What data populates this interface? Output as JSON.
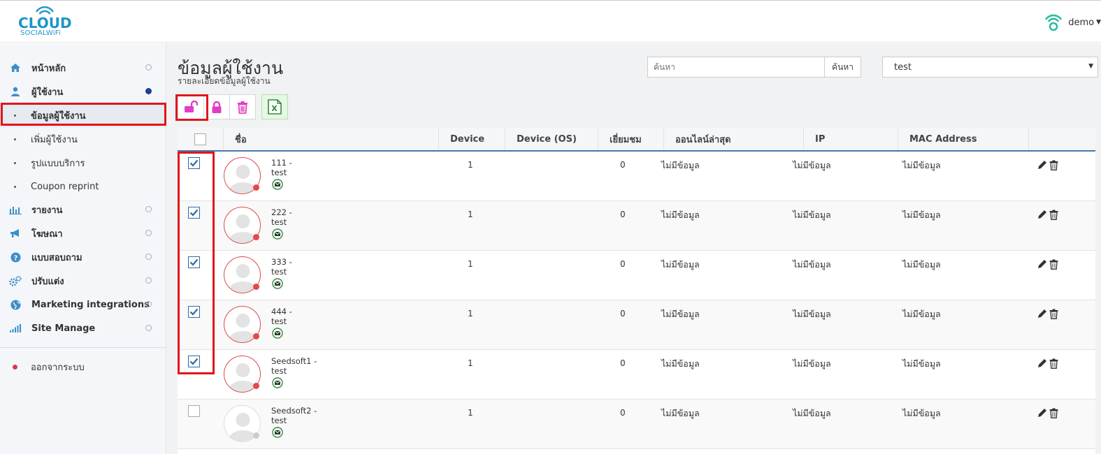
{
  "header": {
    "logo_main": "CLOUD",
    "logo_sub": "SOCIALWiFi",
    "user_name": "demo"
  },
  "sidebar": {
    "items": [
      {
        "label": "หน้าหลัก",
        "icon": "home-icon"
      },
      {
        "label": "ผู้ใช้งาน",
        "icon": "user-icon"
      },
      {
        "label": "รายงาน",
        "icon": "bar-chart-icon"
      },
      {
        "label": "โฆษณา",
        "icon": "megaphone-icon"
      },
      {
        "label": "แบบสอบถาม",
        "icon": "question-icon"
      },
      {
        "label": "ปรับแต่ง",
        "icon": "gears-icon"
      },
      {
        "label": "Marketing integrations",
        "icon": "globe-icon"
      },
      {
        "label": "Site Manage",
        "icon": "signal-icon"
      }
    ],
    "sub_items": [
      {
        "label": "ข้อมูลผู้ใช้งาน",
        "active": true
      },
      {
        "label": "เพิ่มผู้ใช้งาน",
        "active": false
      },
      {
        "label": "รูปแบบบริการ",
        "active": false
      },
      {
        "label": "Coupon reprint",
        "active": false
      }
    ],
    "logout": "ออกจากระบบ"
  },
  "main": {
    "title": "ข้อมูลผู้ใช้งาน",
    "subtitle": "รายละเอียดข้อมูลผู้ใช้งาน",
    "search": {
      "placeholder": "ค้นหา",
      "button": "ค้นหา"
    },
    "site_select": "test"
  },
  "toolbar": {
    "unlock_icon": "unlock-icon",
    "lock_icon": "lock-icon",
    "delete_icon": "trash-icon",
    "excel_icon": "excel-icon"
  },
  "colors": {
    "accent_blue": "#1d95c9",
    "magenta": "#e23ec4",
    "highlight_red": "#e0161b",
    "header_border": "#4a78a8"
  },
  "table": {
    "columns": [
      "ชื่อ",
      "Device",
      "Device (OS)",
      "เยี่ยมชม",
      "ออนไลน์ล่าสุด",
      "IP",
      "MAC Address"
    ],
    "rows": [
      {
        "checked": true,
        "name": "111 -",
        "site": "test",
        "device": "1",
        "os": "",
        "visits": "0",
        "last_online": "ไม่มีข้อมูล",
        "ip": "ไม่มีข้อมูล",
        "mac": "ไม่มีข้อมูล",
        "online": true
      },
      {
        "checked": true,
        "name": "222 -",
        "site": "test",
        "device": "1",
        "os": "",
        "visits": "0",
        "last_online": "ไม่มีข้อมูล",
        "ip": "ไม่มีข้อมูล",
        "mac": "ไม่มีข้อมูล",
        "online": true
      },
      {
        "checked": true,
        "name": "333 -",
        "site": "test",
        "device": "1",
        "os": "",
        "visits": "0",
        "last_online": "ไม่มีข้อมูล",
        "ip": "ไม่มีข้อมูล",
        "mac": "ไม่มีข้อมูล",
        "online": true
      },
      {
        "checked": true,
        "name": "444 -",
        "site": "test",
        "device": "1",
        "os": "",
        "visits": "0",
        "last_online": "ไม่มีข้อมูล",
        "ip": "ไม่มีข้อมูล",
        "mac": "ไม่มีข้อมูล",
        "online": true
      },
      {
        "checked": true,
        "name": "Seedsoft1 -",
        "site": "test",
        "device": "1",
        "os": "",
        "visits": "0",
        "last_online": "ไม่มีข้อมูล",
        "ip": "ไม่มีข้อมูล",
        "mac": "ไม่มีข้อมูล",
        "online": true
      },
      {
        "checked": false,
        "name": "Seedsoft2 -",
        "site": "test",
        "device": "1",
        "os": "",
        "visits": "0",
        "last_online": "ไม่มีข้อมูล",
        "ip": "ไม่มีข้อมูล",
        "mac": "ไม่มีข้อมูล",
        "online": false
      }
    ]
  }
}
